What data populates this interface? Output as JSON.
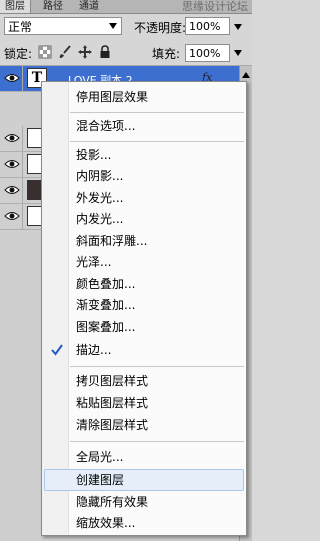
{
  "tabs": [
    "图层",
    "路径",
    "通道"
  ],
  "watermark": "思缘设计论坛",
  "blend_mode": "正常",
  "opacity_label": "不透明度:",
  "opacity_value": "100%",
  "lock_label": "锁定:",
  "fill_label": "填充:",
  "fill_value": "100%",
  "selected_layer": "LOVE 副本 2",
  "fx_label": "fx",
  "menu": {
    "items": [
      "停用图层效果",
      "混合选项...",
      "投影...",
      "内阴影...",
      "外发光...",
      "内发光...",
      "斜面和浮雕...",
      "光泽...",
      "颜色叠加...",
      "渐变叠加...",
      "图案叠加...",
      "描边...",
      "拷贝图层样式",
      "粘贴图层样式",
      "清除图层样式",
      "全局光...",
      "创建图层",
      "隐藏所有效果",
      "缩放效果..."
    ],
    "checked_item": "描边...",
    "highlighted_item": "创建图层"
  },
  "icons": [
    "eye-icon",
    "lock-transparency-icon",
    "brush-icon",
    "move-icon",
    "lock-icon",
    "checkmark-icon"
  ]
}
